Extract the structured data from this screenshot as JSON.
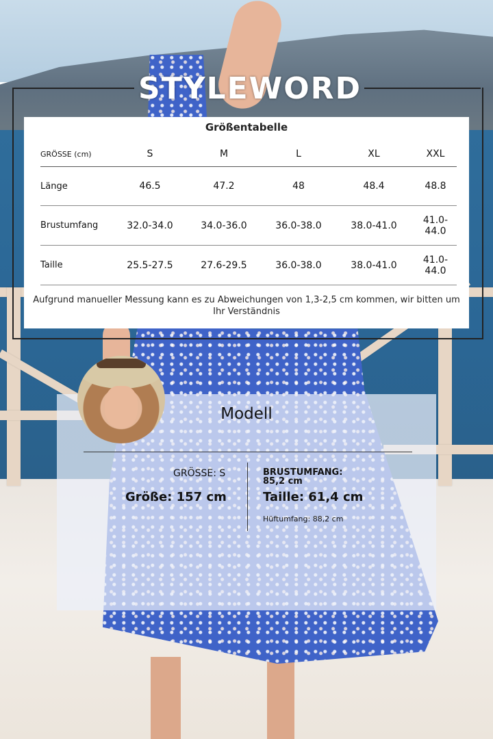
{
  "brand": "STYLEWORD",
  "size_chart": {
    "title": "Größentabelle",
    "header_label": "GRÖSSE (cm)",
    "sizes": [
      "S",
      "M",
      "L",
      "XL",
      "XXL"
    ],
    "rows": [
      {
        "label": "Länge",
        "values": [
          "46.5",
          "47.2",
          "48",
          "48.4",
          "48.8"
        ]
      },
      {
        "label": "Brustumfang",
        "values": [
          "32.0-34.0",
          "34.0-36.0",
          "36.0-38.0",
          "38.0-41.0",
          "41.0-44.0"
        ]
      },
      {
        "label": "Taille",
        "values": [
          "25.5-27.5",
          "27.6-29.5",
          "36.0-38.0",
          "38.0-41.0",
          "41.0-44.0"
        ]
      }
    ],
    "note": "Aufgrund manueller Messung kann es zu Abweichungen von 1,3-2,5 cm kommen, wir bitten um Ihr Verständnis"
  },
  "model": {
    "title": "Modell",
    "size": "GRÖSSE: S",
    "height": "Größe: 157 cm",
    "bust": "BRUSTUMFANG: 85,2 cm",
    "waist": "Taille: 61,4 cm",
    "hip": "Hüftumfang: 88,2 cm"
  },
  "colors": {
    "dress": "#3f63c8",
    "sea": "#2f6d9b",
    "card": "#ffffff",
    "panel": "rgba(235,240,250,0.72)"
  }
}
